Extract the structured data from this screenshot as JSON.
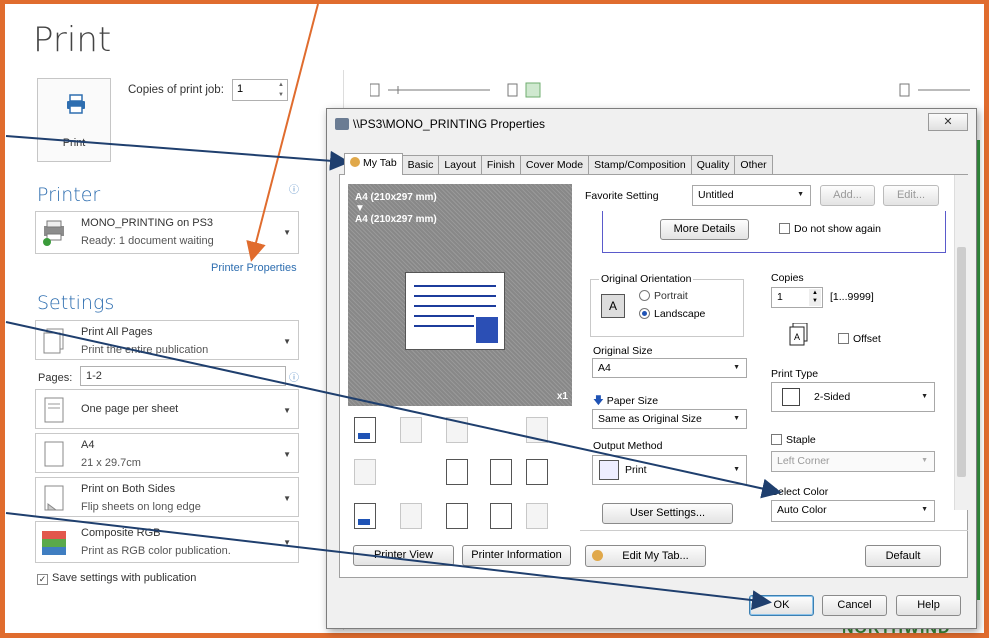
{
  "backstage": {
    "title": "Print",
    "print_button_label": "Print",
    "copies_label": "Copies of print job:",
    "copies_value": "1",
    "printer_heading": "Printer",
    "printer_name": "MONO_PRINTING on PS3",
    "printer_status": "Ready: 1 document waiting",
    "printer_properties_link": "Printer Properties",
    "settings_heading": "Settings",
    "settings": [
      {
        "title": "Print All Pages",
        "subtitle": "Print the entire publication"
      },
      {
        "title": "One page per sheet",
        "subtitle": ""
      },
      {
        "title": "A4",
        "subtitle": "21 x 29.7cm"
      },
      {
        "title": "Print on Both Sides",
        "subtitle": "Flip sheets on long edge"
      },
      {
        "title": "Composite RGB",
        "subtitle": "Print as RGB color publication."
      }
    ],
    "pages_label": "Pages:",
    "pages_value": "1-2",
    "save_settings_label": "Save settings with publication",
    "footer_text": "NORTHWIND"
  },
  "dialog": {
    "title": "\\\\PS3\\MONO_PRINTING Properties",
    "close_glyph": "✕",
    "tabs": [
      "My Tab",
      "Basic",
      "Layout",
      "Finish",
      "Cover Mode",
      "Stamp/Composition",
      "Quality",
      "Other"
    ],
    "preview": {
      "top_text": "A4 (210x297 mm)",
      "arrow": "▼",
      "bottom_text": "A4 (210x297 mm)",
      "multiplier": "x1"
    },
    "printer_view_btn": "Printer View",
    "printer_info_btn": "Printer Information",
    "favorite_label": "Favorite Setting",
    "favorite_value": "Untitled",
    "add_btn": "Add...",
    "edit_btn": "Edit...",
    "more_details_btn": "More Details",
    "dont_show_label": "Do not show again",
    "orientation_label": "Original Orientation",
    "portrait_label": "Portrait",
    "landscape_label": "Landscape",
    "original_size_label": "Original Size",
    "original_size_value": "A4",
    "paper_size_label": "Paper Size",
    "paper_size_value": "Same as Original Size",
    "output_method_label": "Output Method",
    "output_method_value": "Print",
    "user_settings_btn": "User Settings...",
    "copies_label": "Copies",
    "copies_value": "1",
    "copies_range": "[1...9999]",
    "offset_label": "Offset",
    "print_type_label": "Print Type",
    "print_type_value": "2-Sided",
    "staple_label": "Staple",
    "staple_value": "Left Corner",
    "select_color_label": "Select Color",
    "select_color_value": "Auto Color",
    "edit_my_tab_btn": "Edit My Tab...",
    "default_btn": "Default",
    "ok_btn": "OK",
    "cancel_btn": "Cancel",
    "help_btn": "Help"
  },
  "colors": {
    "frame": "#e06c2e",
    "arrow": "#1f3f6e",
    "accent": "#2e6eb0"
  }
}
